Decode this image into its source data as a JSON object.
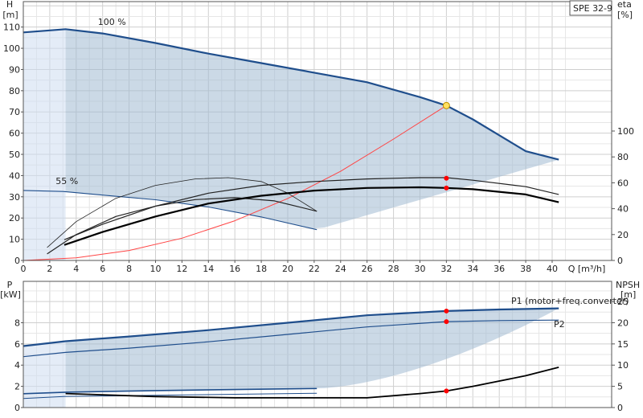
{
  "chart_data": [
    {
      "type": "line",
      "title_box": "SPE 32-9",
      "ylabel_left": "H",
      "yunit_left": "[m]",
      "ylabel_right": "eta",
      "yunit_right": "[%]",
      "xlabel": "Q [m³/h]",
      "xlim": [
        0,
        44.5
      ],
      "ylim_left": [
        0,
        122
      ],
      "ylim_right": [
        0,
        200
      ],
      "x_ticks": [
        "0",
        "2",
        "4",
        "6",
        "8",
        "10",
        "12",
        "14",
        "16",
        "18",
        "20",
        "22",
        "24",
        "26",
        "28",
        "30",
        "32",
        "34",
        "36",
        "38",
        "40"
      ],
      "y_ticks_left": [
        "0",
        "10",
        "20",
        "30",
        "40",
        "50",
        "60",
        "70",
        "80",
        "90",
        "100",
        "110"
      ],
      "y_ticks_right": [
        "0",
        "20",
        "40",
        "60",
        "80",
        "100"
      ],
      "grid": true,
      "annotations": [
        {
          "text": "100 %",
          "x": 6.7,
          "y": 111
        },
        {
          "text": "55 %",
          "x": 3.3,
          "y": 36
        }
      ],
      "operating_point": {
        "x": 32,
        "y": 73
      },
      "series": [
        {
          "id": "head_100",
          "color": "#1f4e8c",
          "axis": "left",
          "x": [
            0,
            3.2,
            6,
            10,
            14,
            18,
            22,
            26,
            30,
            32,
            34,
            36,
            38,
            40.5
          ],
          "y": [
            107.5,
            109,
            107,
            102.5,
            97.5,
            93,
            88.5,
            84,
            77,
            73,
            66.5,
            59,
            51.5,
            47.5
          ]
        },
        {
          "id": "head_55",
          "color": "#1f4e8c",
          "axis": "left",
          "x": [
            0,
            3,
            6,
            10,
            14,
            18,
            22.2
          ],
          "y": [
            33,
            32.5,
            30.8,
            28.6,
            25.2,
            20.5,
            14.5
          ]
        },
        {
          "id": "system_curve",
          "color": "#ff4444",
          "axis": "left",
          "x": [
            0,
            4,
            8,
            12,
            16,
            20,
            24,
            28,
            32
          ],
          "y": [
            0,
            1.2,
            4.7,
            10.5,
            18.7,
            29.2,
            42,
            57.2,
            73
          ]
        },
        {
          "id": "eta_thin_min",
          "color": "#222222",
          "axis": "right",
          "x": [
            1.8,
            4,
            7,
            10,
            13,
            15.5,
            18,
            20,
            22.2
          ],
          "y": [
            10,
            30,
            48,
            58,
            63,
            64,
            61,
            52,
            38
          ]
        },
        {
          "id": "eta_thin_max",
          "color": "#222222",
          "axis": "right",
          "x": [
            3.1,
            6,
            10,
            14,
            18,
            22,
            26,
            30,
            32,
            34,
            38,
            40.5
          ],
          "y": [
            16,
            28,
            42,
            52,
            58,
            61,
            63,
            64,
            64,
            62,
            57,
            51
          ]
        },
        {
          "id": "eta_total_min",
          "color": "#222222",
          "axis": "right",
          "x": [
            1.8,
            4,
            7,
            10,
            13,
            16,
            19,
            22.2
          ],
          "y": [
            5,
            20,
            34,
            42,
            47,
            48.5,
            46,
            38
          ]
        },
        {
          "id": "eta_total_max",
          "color": "#000000",
          "axis": "right",
          "x": [
            3.1,
            6,
            10,
            14,
            18,
            22,
            26,
            30,
            32,
            34,
            38,
            40.5
          ],
          "y": [
            12,
            22,
            34,
            44,
            50,
            54,
            56,
            56.5,
            56,
            55,
            51,
            45
          ]
        }
      ],
      "op_markers": [
        {
          "axis": "right",
          "x": 32,
          "y": 63.5
        },
        {
          "axis": "right",
          "x": 32,
          "y": 56
        }
      ]
    },
    {
      "type": "line",
      "ylabel_left": "P",
      "yunit_left": "[kW]",
      "ylabel_right": "NPSH",
      "yunit_right": "[m]",
      "xlim": [
        0,
        44.5
      ],
      "ylim_left": [
        0,
        11.9
      ],
      "ylim_right": [
        0,
        29.75
      ],
      "y_ticks_left": [
        "0",
        "2",
        "4",
        "6",
        "8"
      ],
      "y_ticks_right": [
        "0",
        "5",
        "10",
        "15",
        "20",
        "25"
      ],
      "grid": true,
      "series": [
        {
          "id": "P1_100",
          "name": "P1 (motor+freq.converter)",
          "color": "#1f4e8c",
          "axis": "left",
          "x": [
            0,
            3.2,
            8,
            14,
            20,
            26,
            32,
            36,
            40.5
          ],
          "y": [
            5.8,
            6.25,
            6.7,
            7.3,
            8.0,
            8.7,
            9.1,
            9.25,
            9.35
          ]
        },
        {
          "id": "P2_100",
          "name": "P2",
          "color": "#1f4e8c",
          "axis": "left",
          "x": [
            0,
            3.2,
            8,
            14,
            20,
            26,
            32,
            36,
            40.5
          ],
          "y": [
            4.8,
            5.2,
            5.6,
            6.2,
            6.9,
            7.6,
            8.1,
            8.2,
            8.25
          ]
        },
        {
          "id": "P1_55",
          "color": "#1f4e8c",
          "axis": "left",
          "x": [
            0,
            3.2,
            10,
            16,
            22.2
          ],
          "y": [
            1.3,
            1.45,
            1.6,
            1.7,
            1.8
          ]
        },
        {
          "id": "P2_55",
          "color": "#1f4e8c",
          "axis": "left",
          "x": [
            0,
            3.2,
            10,
            16,
            22.2
          ],
          "y": [
            0.85,
            1.05,
            1.15,
            1.25,
            1.35
          ]
        },
        {
          "id": "npsh",
          "color": "#000000",
          "axis": "right",
          "x": [
            3.2,
            10,
            16,
            20,
            22,
            26,
            30,
            32,
            34,
            38,
            40.5
          ],
          "y": [
            3.3,
            2.6,
            2.3,
            2.3,
            2.3,
            2.3,
            3.3,
            3.9,
            5,
            7.5,
            9.5
          ]
        }
      ],
      "op_markers": [
        {
          "axis": "left",
          "x": 32,
          "y": 9.1
        },
        {
          "axis": "left",
          "x": 32,
          "y": 8.1
        },
        {
          "axis": "right",
          "x": 32,
          "y": 3.9
        }
      ]
    }
  ]
}
